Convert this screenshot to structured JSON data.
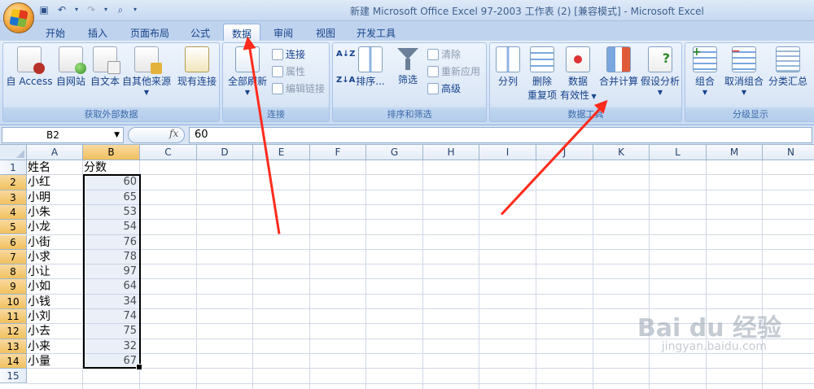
{
  "window": {
    "title": "新建 Microsoft Office Excel 97-2003 工作表 (2)  [兼容模式] - Microsoft Excel"
  },
  "qat": {
    "save_icon": "save-icon",
    "undo_icon": "undo-icon",
    "redo_icon": "redo-icon",
    "preview_icon": "print-preview-icon"
  },
  "tabs": [
    {
      "label": "开始"
    },
    {
      "label": "插入"
    },
    {
      "label": "页面布局"
    },
    {
      "label": "公式"
    },
    {
      "label": "数据",
      "active": true
    },
    {
      "label": "审阅"
    },
    {
      "label": "视图"
    },
    {
      "label": "开发工具"
    }
  ],
  "ribbon": {
    "external": {
      "label": "获取外部数据",
      "access": "自 Access",
      "web": "自网站",
      "text": "自文本",
      "other": "自其他来源",
      "existing": "现有连接"
    },
    "connections": {
      "label": "连接",
      "refresh_all": "全部刷新",
      "connections": "连接",
      "properties": "属性",
      "edit_links": "编辑链接"
    },
    "sort_filter": {
      "label": "排序和筛选",
      "sort_az": "A↓Z",
      "sort_za": "Z↓A",
      "sort": "排序...",
      "filter": "筛选",
      "clear": "清除",
      "reapply": "重新应用",
      "advanced": "高级"
    },
    "data_tools": {
      "label": "数据工具",
      "text_to_columns": "分列",
      "remove_dup_1": "删除",
      "remove_dup_2": "重复项",
      "validation_1": "数据",
      "validation_2": "有效性",
      "consolidate": "合并计算",
      "what_if": "假设分析"
    },
    "outline": {
      "label": "分级显示",
      "group": "组合",
      "ungroup": "取消组合",
      "subtotal": "分类汇总"
    }
  },
  "formula_bar": {
    "name_box": "B2",
    "fx": "fx",
    "value": "60"
  },
  "sheet": {
    "columns": [
      "A",
      "B",
      "C",
      "D",
      "E",
      "F",
      "G",
      "H",
      "I",
      "J",
      "K",
      "L",
      "M",
      "N"
    ],
    "rows": [
      "1",
      "2",
      "3",
      "4",
      "5",
      "6",
      "7",
      "8",
      "9",
      "10",
      "11",
      "12",
      "13",
      "14",
      "15"
    ],
    "data": [
      [
        "姓名",
        "分数"
      ],
      [
        "小红",
        "60"
      ],
      [
        "小明",
        "65"
      ],
      [
        "小朱",
        "53"
      ],
      [
        "小龙",
        "54"
      ],
      [
        "小街",
        "76"
      ],
      [
        "小求",
        "78"
      ],
      [
        "小让",
        "97"
      ],
      [
        "小如",
        "64"
      ],
      [
        "小钱",
        "34"
      ],
      [
        "小刘",
        "74"
      ],
      [
        "小去",
        "75"
      ],
      [
        "小来",
        "32"
      ],
      [
        "小量",
        "67"
      ]
    ],
    "selection": "B2:B14"
  },
  "watermark": {
    "brand": "Bai du 经验",
    "site": "jingyan.baidu.com"
  },
  "colors": {
    "ribbon_bg": "#d3e2f5",
    "accent": "#15428b",
    "annotation_arrow": "#ff2b1c"
  }
}
